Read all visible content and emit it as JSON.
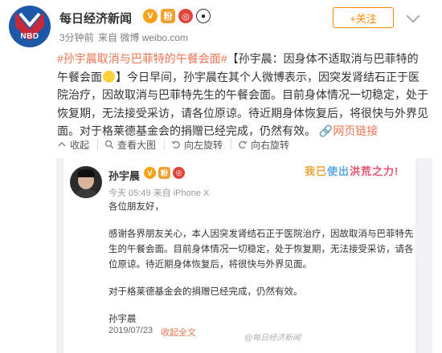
{
  "account": {
    "name": "每日经济新闻",
    "avatar_text": "NBD",
    "time": "3分钟前",
    "source": "来自 微博 weibo.com",
    "follow_label": "+关注"
  },
  "post": {
    "hashtag": "#孙宇晨取消与巴菲特的午餐会面#",
    "headline": "【孙宇晨：因身体不适取消与巴菲特的午餐会面",
    "headline_end": "】",
    "body": "今日早间，孙宇晨在其个人微博表示，因突发肾结石正于医院治疗，因故取消与巴菲特先生的午餐会面。目前身体情况一切稳定，处于恢复期，无法接受采访，请各位原谅。待近期身体恢复后，将很快与外界见面。对于格莱德基金会的捐赠已经完成，仍然有效。",
    "link_label": "网页链接"
  },
  "actions": {
    "collapse": "收起",
    "view_large": "查看大图",
    "rotate_left": "向左旋转",
    "rotate_right": "向右旋转"
  },
  "card": {
    "name": "孙宇晨",
    "meta": "今天 05:49 来自 iPhone X",
    "banner_part1": "我已",
    "banner_part2": "使出",
    "banner_part3": "洪荒之力!",
    "greeting": "各位朋友好，",
    "para1": "感谢各界朋友关心，本人因突发肾结石正于医院治疗，因故取消与巴菲特先生的午餐会面。目前身体情况一切稳定，处于恢复期，无法接受采访，请各位原谅。待近期身体恢复后，将很快与外界见面。",
    "para2": "对于格莱德基金会的捐赠已经完成，仍然有效。",
    "signature": "孙宇晨",
    "date": "2019/07/23",
    "collapse_label": "收起全文",
    "watermark": "@每日经济新闻"
  },
  "colors": {
    "accent": "#eb7350",
    "follow": "#ff8200",
    "nbd_blue": "#1d57a8"
  }
}
